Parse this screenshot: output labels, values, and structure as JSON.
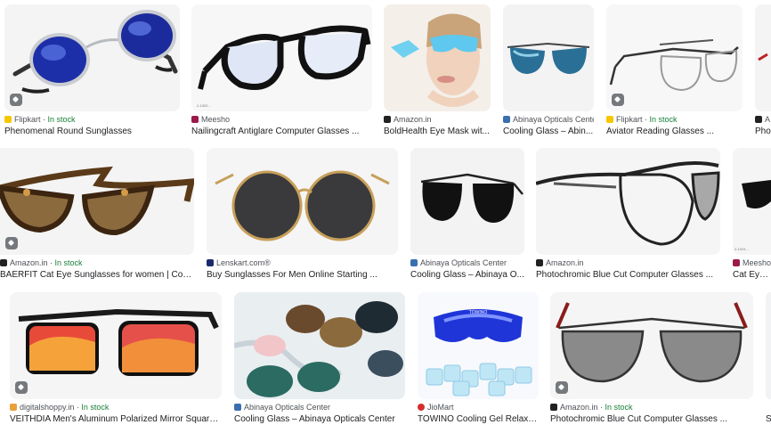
{
  "results": [
    {
      "site": "Flipkart",
      "stock": "In stock",
      "title": "Phenomenal Round Sunglasses",
      "icon": "flipkart-favicon",
      "color": "#f7c600"
    },
    {
      "site": "Meesho",
      "stock": "",
      "title": "Nailingcraft Antiglare Computer Glasses ...",
      "icon": "meesho-favicon",
      "color": "#9b1a4a"
    },
    {
      "site": "Amazon.in",
      "stock": "",
      "title": "BoldHealth Eye Mask wit...",
      "icon": "amazon-favicon",
      "color": "#222222"
    },
    {
      "site": "Abinaya Opticals Cente...",
      "stock": "",
      "title": "Cooling Glass – Abin...",
      "icon": "abinaya-favicon",
      "color": "#3a6fb0"
    },
    {
      "site": "Flipkart",
      "stock": "In stock",
      "title": "Aviator Reading Glasses ...",
      "icon": "flipkart-favicon",
      "color": "#f7c600"
    },
    {
      "site": "A",
      "stock": "",
      "title": "Pho",
      "icon": "amazon-favicon",
      "color": "#222222"
    },
    {
      "site": "Amazon.in",
      "stock": "In stock",
      "title": "BAERFIT Cat Eye Sunglasses for women | Cooling...",
      "icon": "amazon-favicon",
      "color": "#222222"
    },
    {
      "site": "Lenskart.com®",
      "stock": "",
      "title": "Buy Sunglasses For Men Online Starting ...",
      "icon": "lenskart-favicon",
      "color": "#1a2a6c"
    },
    {
      "site": "Abinaya Opticals Center",
      "stock": "",
      "title": "Cooling Glass – Abinaya O...",
      "icon": "abinaya-favicon",
      "color": "#3a6fb0"
    },
    {
      "site": "Amazon.in",
      "stock": "",
      "title": "Photochromic Blue Cut Computer Glasses ...",
      "icon": "amazon-favicon",
      "color": "#222222"
    },
    {
      "site": "Meesho",
      "stock": "",
      "title": "Cat Eye S",
      "icon": "meesho-favicon",
      "color": "#9b1a4a"
    },
    {
      "site": "digitalshoppy.in",
      "stock": "In stock",
      "title": "VEITHDIA Men's Aluminum Polarized Mirror Square G...",
      "icon": "digitalshoppy-favicon",
      "color": "#e8a13a"
    },
    {
      "site": "Abinaya Opticals Center",
      "stock": "",
      "title": "Cooling Glass – Abinaya Opticals Center",
      "icon": "abinaya-favicon",
      "color": "#3a6fb0"
    },
    {
      "site": "JioMart",
      "stock": "",
      "title": "TOWINO Cooling Gel Relaxin...",
      "icon": "jiomart-favicon",
      "color": "#d32f2f"
    },
    {
      "site": "Amazon.in",
      "stock": "In stock",
      "title": "Photochromic Blue Cut Computer Glasses ...",
      "icon": "amazon-favicon",
      "color": "#222222"
    },
    {
      "site": "",
      "stock": "",
      "title": "S",
      "icon": "",
      "color": "#cccccc"
    }
  ],
  "image_text": {
    "towino": "TOWINO"
  }
}
